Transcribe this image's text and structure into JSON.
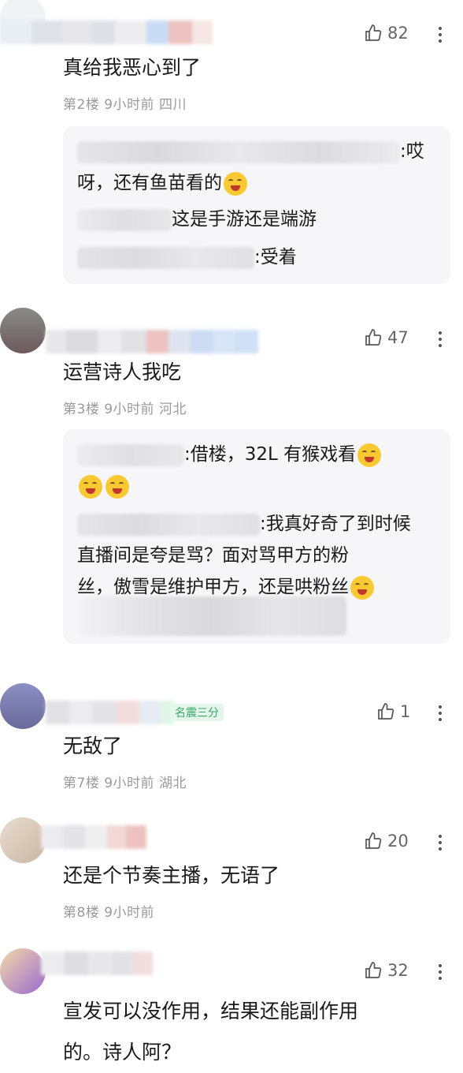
{
  "comments": [
    {
      "likes": "82",
      "text": "真给我恶心到了",
      "meta": "第2楼  9小时前  四川",
      "replies": [
        {
          "text_line1": ":哎",
          "text_line2": "呀，还有鱼苗看的"
        },
        {
          "text": "这是手游还是端游"
        },
        {
          "text": ":受着"
        }
      ]
    },
    {
      "likes": "47",
      "text": "运营诗人我吃",
      "meta": "第3楼  9小时前  河北",
      "replies": [
        {
          "text": ":借楼，32L 有猴戏看"
        },
        {
          "text_line1": ":我真好奇了到时候",
          "text_line2": "直播间是夸是骂？面对骂甲方的粉",
          "text_line3": "丝，傲雪是维护甲方，还是哄粉丝"
        }
      ]
    },
    {
      "likes": "1",
      "tag": "名震三分",
      "text": "无敌了",
      "meta": "第7楼  9小时前  湖北"
    },
    {
      "likes": "20",
      "text": "还是个节奏主播，无语了",
      "meta": "第8楼  9小时前"
    },
    {
      "likes": "32",
      "text_line1": "宣发可以没作用，结果还能副作用",
      "text_line2": "的。诗人阿？"
    }
  ],
  "icons": {
    "like": "thumbs-up-icon",
    "more": "more-vertical-icon"
  },
  "colors": {
    "reply_bg": "#f6f6f9",
    "meta": "#9a9a9a",
    "tag_green": "#3aa86b"
  }
}
